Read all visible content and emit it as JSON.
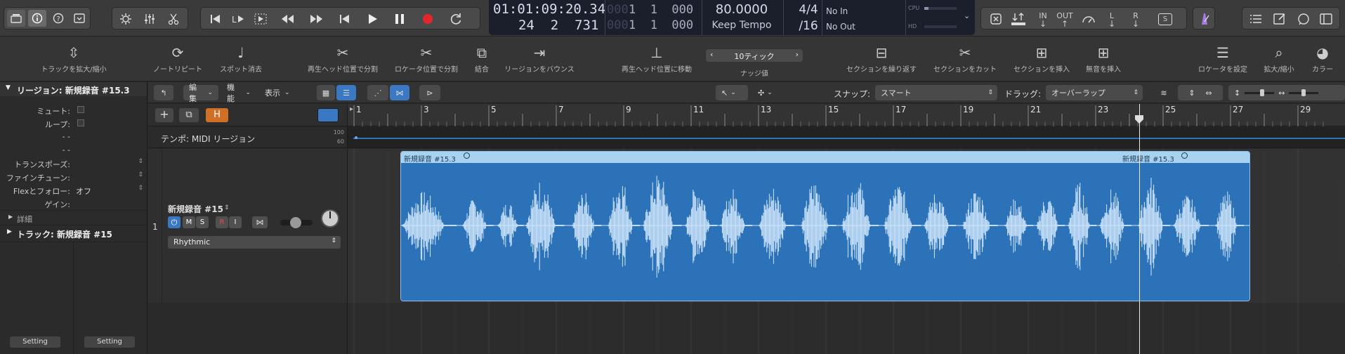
{
  "lcd": {
    "time": "01:01:09:20.34",
    "bars": "24  2  731",
    "beats_dim_1": "0001",
    "beats_1": "1  1  000",
    "beats_dim_2": "0001",
    "beats_2": "1  1  000",
    "tempo": "80.0000",
    "tempo_mode": "Keep Tempo",
    "sig_num": "4/4",
    "sig_den": "/16",
    "midi_in": "No In",
    "midi_out": "No Out",
    "cpu_label": "CPU",
    "hd_label": "HD"
  },
  "ctl_right": {
    "in_label": "IN",
    "out_label": "OUT",
    "l_label": "L",
    "r_label": "R",
    "s_label": "S"
  },
  "toolbar": {
    "items": [
      {
        "label": "トラックを拡大/縮小"
      },
      {
        "label": "ノートリピート"
      },
      {
        "label": "スポット消去"
      },
      {
        "label": "再生ヘッド位置で分割"
      },
      {
        "label": "ロケータ位置で分割"
      },
      {
        "label": "結合"
      },
      {
        "label": "リージョンをバウンス"
      },
      {
        "label": "再生ヘッド位置に移動"
      },
      {
        "label": "ナッジ値"
      },
      {
        "label": "セクションを繰り返す"
      },
      {
        "label": "セクションをカット"
      },
      {
        "label": "セクションを挿入"
      },
      {
        "label": "無音を挿入"
      },
      {
        "label": "ロケータを設定"
      },
      {
        "label": "拡大/縮小"
      },
      {
        "label": "カラー"
      }
    ],
    "nudge_value": "10ティック"
  },
  "inspector": {
    "region_header": "リージョン: 新規録音 #15.3",
    "mute_label": "ミュート:",
    "loop_label": "ループ:",
    "dash1": "- -",
    "dash2": "- -",
    "transpose_label": "トランスポーズ:",
    "finetune_label": "ファインチューン:",
    "flex_label": "Flexとフォロー:",
    "flex_value": "オフ",
    "gain_label": "ゲイン:",
    "details": "詳細",
    "track_header": "トラック: 新規録音 #15",
    "setting_1": "Setting",
    "setting_2": "Setting"
  },
  "editbar": {
    "edit": "編集",
    "func": "機能",
    "view": "表示",
    "snap_label": "スナップ:",
    "snap_value": "スマート",
    "drag_label": "ドラッグ:",
    "drag_value": "オーバーラップ"
  },
  "tracks_header": {
    "tempo_track": "テンポ: MIDI リージョン",
    "tempo_top": "100",
    "tempo_bottom": "60",
    "h_label": "H"
  },
  "track": {
    "number": "1",
    "name": "新規録音 #15",
    "m": "M",
    "s": "S",
    "r": "R",
    "i": "I",
    "flex_mode": "Rhythmic"
  },
  "ruler": {
    "bars": [
      "1",
      "3",
      "5",
      "7",
      "9",
      "11",
      "13",
      "15",
      "17",
      "19",
      "21",
      "23",
      "25",
      "27",
      "29"
    ]
  },
  "region": {
    "name": "新規録音 #15.3",
    "name_repeat": "新規録音 #15.3",
    "color": "#2b72b8",
    "header_color": "#a9d2f0",
    "wave_color": "#cfe6fb"
  }
}
